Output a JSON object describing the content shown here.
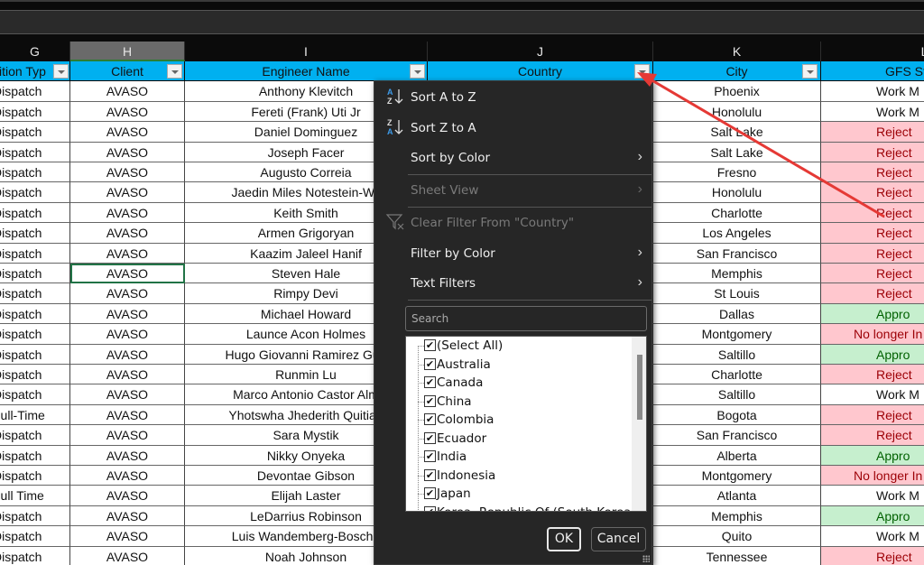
{
  "columns": {
    "letters": [
      "G",
      "H",
      "I",
      "J",
      "K",
      "L"
    ],
    "selected": "H"
  },
  "table": {
    "headers": [
      "Position Type",
      "Client",
      "Engineer Name",
      "Country",
      "City",
      "GFS Status"
    ],
    "header_visible": [
      "sition Typ",
      "Client",
      "Engineer Name",
      "Country",
      "City",
      "GFS Sta"
    ],
    "rows": [
      {
        "pos": "Dispatch",
        "client": "AVASO",
        "name": "Anthony Klevitch",
        "city": "Phoenix",
        "status": "Work M",
        "status_kind": "plain"
      },
      {
        "pos": "Dispatch",
        "client": "AVASO",
        "name": "Fereti (Frank) Uti Jr",
        "city": "Honolulu",
        "status": "Work M",
        "status_kind": "plain"
      },
      {
        "pos": "Dispatch",
        "client": "AVASO",
        "name": "Daniel Dominguez",
        "city": "Salt Lake",
        "status": "Reject",
        "status_kind": "rej"
      },
      {
        "pos": "Dispatch",
        "client": "AVASO",
        "name": "Joseph Facer",
        "city": "Salt Lake",
        "status": "Reject",
        "status_kind": "rej"
      },
      {
        "pos": "Dispatch",
        "client": "AVASO",
        "name": "Augusto Correia",
        "city": "Fresno",
        "status": "Reject",
        "status_kind": "rej"
      },
      {
        "pos": "Dispatch",
        "client": "AVASO",
        "name": "Jaedin Miles Notestein-Wil",
        "city": "Honolulu",
        "status": "Reject",
        "status_kind": "rej"
      },
      {
        "pos": "Dispatch",
        "client": "AVASO",
        "name": "Keith Smith",
        "city": "Charlotte",
        "status": "Reject",
        "status_kind": "rej"
      },
      {
        "pos": "Dispatch",
        "client": "AVASO",
        "name": "Armen Grigoryan",
        "city": "Los Angeles",
        "status": "Reject",
        "status_kind": "rej"
      },
      {
        "pos": "Dispatch",
        "client": "AVASO",
        "name": "Kaazim Jaleel Hanif",
        "city": "San Francisco",
        "status": "Reject",
        "status_kind": "rej"
      },
      {
        "pos": "Dispatch",
        "client": "AVASO",
        "name": "Steven Hale",
        "city": "Memphis",
        "status": "Reject",
        "status_kind": "rej"
      },
      {
        "pos": "Dispatch",
        "client": "AVASO",
        "name": "Rimpy Devi",
        "city": "St Louis",
        "status": "Reject",
        "status_kind": "rej"
      },
      {
        "pos": "Dispatch",
        "client": "AVASO",
        "name": "Michael Howard",
        "city": "Dallas",
        "status": "Appro",
        "status_kind": "app"
      },
      {
        "pos": "Dispatch",
        "client": "AVASO",
        "name": "Launce Acon Holmes",
        "city": "Montgomery",
        "status": "No longer In",
        "status_kind": "rej"
      },
      {
        "pos": "Dispatch",
        "client": "AVASO",
        "name": "Hugo Giovanni Ramirez Gue",
        "city": "Saltillo",
        "status": "Appro",
        "status_kind": "app"
      },
      {
        "pos": "Dispatch",
        "client": "AVASO",
        "name": "Runmin Lu",
        "city": "Charlotte",
        "status": "Reject",
        "status_kind": "rej"
      },
      {
        "pos": "Dispatch",
        "client": "AVASO",
        "name": "Marco Antonio Castor Alm",
        "city": "Saltillo",
        "status": "Work M",
        "status_kind": "plain"
      },
      {
        "pos": "Full-Time",
        "client": "AVASO",
        "name": "Yhotswha Jhederith Quitian",
        "city": "Bogota",
        "status": "Reject",
        "status_kind": "rej"
      },
      {
        "pos": "Dispatch",
        "client": "AVASO",
        "name": "Sara Mystik",
        "city": "San Francisco",
        "status": "Reject",
        "status_kind": "rej"
      },
      {
        "pos": "Dispatch",
        "client": "AVASO",
        "name": "Nikky Onyeka",
        "city": "Alberta",
        "status": "Appro",
        "status_kind": "app"
      },
      {
        "pos": "Dispatch",
        "client": "AVASO",
        "name": "Devontae Gibson",
        "city": "Montgomery",
        "status": "No longer In",
        "status_kind": "rej"
      },
      {
        "pos": "Full Time",
        "client": "AVASO",
        "name": "Elijah Laster",
        "city": "Atlanta",
        "status": "Work M",
        "status_kind": "plain"
      },
      {
        "pos": "Dispatch",
        "client": "AVASO",
        "name": "LeDarrius Robinson",
        "city": "Memphis",
        "status": "Appro",
        "status_kind": "app"
      },
      {
        "pos": "Dispatch",
        "client": "AVASO",
        "name": "Luis Wandemberg-Bosche",
        "city": "Quito",
        "status": "Work M",
        "status_kind": "plain"
      },
      {
        "pos": "Dispatch",
        "client": "AVASO",
        "name": "Noah Johnson",
        "city": "Tennessee",
        "status": "Reject",
        "status_kind": "rej"
      }
    ],
    "selected_cell": {
      "row": 9,
      "col": "Client"
    }
  },
  "filter_menu": {
    "sort_az": "Sort A to Z",
    "sort_za": "Sort Z to A",
    "sort_by_color": "Sort by Color",
    "sheet_view": "Sheet View",
    "clear_filter": "Clear Filter From \"Country\"",
    "filter_by_color": "Filter by Color",
    "text_filters": "Text Filters",
    "search_placeholder": "Search",
    "items": [
      {
        "label": "(Select All)",
        "checked": true
      },
      {
        "label": "Australia",
        "checked": true
      },
      {
        "label": "Canada",
        "checked": true
      },
      {
        "label": "China",
        "checked": true
      },
      {
        "label": "Colombia",
        "checked": true
      },
      {
        "label": "Ecuador",
        "checked": true
      },
      {
        "label": "India",
        "checked": true
      },
      {
        "label": "Indonesia",
        "checked": true
      },
      {
        "label": "Japan",
        "checked": true
      },
      {
        "label": "Korea, Republic Of (South Korea)",
        "checked": true
      }
    ],
    "ok": "OK",
    "cancel": "Cancel"
  },
  "annotation": {
    "type": "arrow",
    "color": "#e53935",
    "points_to": "country-filter-button"
  },
  "colors": {
    "header_fill": "#00b0f0",
    "reject_fill": "#ffc7ce",
    "reject_text": "#9c0006",
    "approve_fill": "#c6efce",
    "approve_text": "#006100"
  }
}
